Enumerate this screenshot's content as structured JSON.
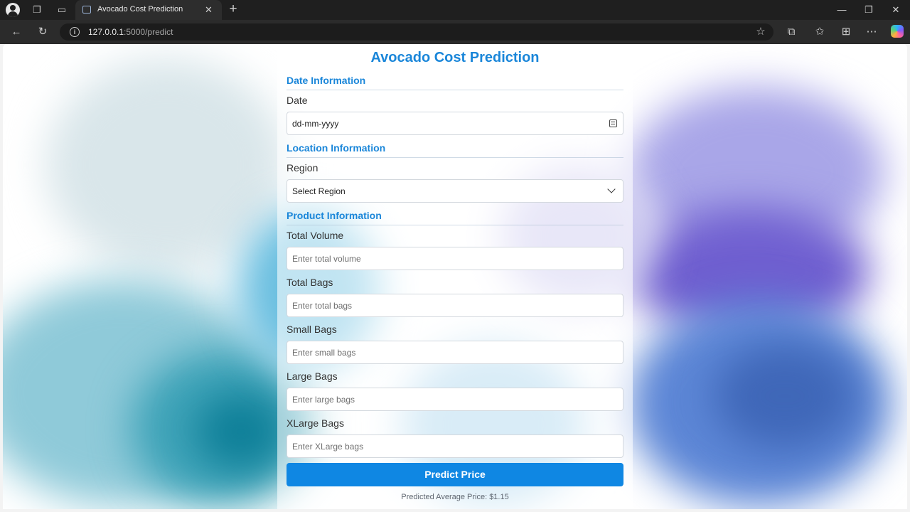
{
  "browser": {
    "tab_title": "Avocado Cost Prediction",
    "url_host": "127.0.0.1",
    "url_path": ":5000/predict",
    "icons": [
      "profile-icon",
      "workspaces-icon",
      "tab-actions-icon",
      "page-favicon",
      "tab-close-icon",
      "new-tab-icon",
      "minimize-icon",
      "restore-icon",
      "window-close-icon",
      "back-icon",
      "refresh-icon",
      "site-info-icon",
      "favorite-star-icon",
      "extensions-icon",
      "favorites-icon",
      "collections-icon",
      "more-icon",
      "copilot-icon"
    ]
  },
  "page": {
    "title": "Avocado Cost Prediction",
    "sections": {
      "date": "Date Information",
      "location": "Location Information",
      "product": "Product Information"
    },
    "fields": {
      "date": {
        "label": "Date",
        "placeholder": "dd-mm-yyyy"
      },
      "region": {
        "label": "Region",
        "selected": "Select Region"
      },
      "total_volume": {
        "label": "Total Volume",
        "placeholder": "Enter total volume"
      },
      "total_bags": {
        "label": "Total Bags",
        "placeholder": "Enter total bags"
      },
      "small_bags": {
        "label": "Small Bags",
        "placeholder": "Enter small bags"
      },
      "large_bags": {
        "label": "Large Bags",
        "placeholder": "Enter large bags"
      },
      "xlarge_bags": {
        "label": "XLarge Bags",
        "placeholder": "Enter XLarge bags"
      }
    },
    "predict_button": "Predict Price",
    "result": "Predicted Average Price: $1.15"
  },
  "colors": {
    "accent": "#1a86d9",
    "button": "#0f87e3",
    "chrome_dark": "#1f1f1f"
  }
}
